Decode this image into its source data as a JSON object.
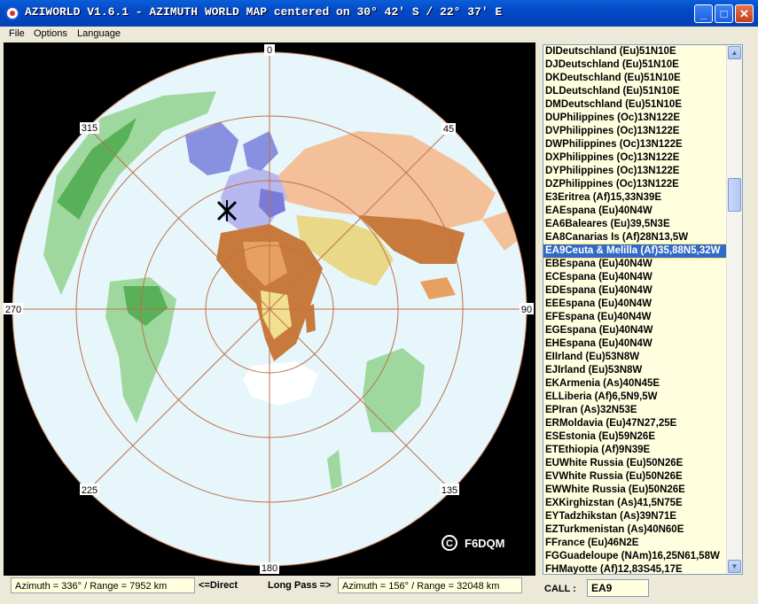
{
  "window": {
    "title": "AZIWORLD V1.6.1 - AZIMUTH WORLD MAP centered on 30° 42' S / 22° 37' E",
    "minimize": "_",
    "maximize": "□",
    "close": "✕"
  },
  "menu": {
    "items": [
      "File",
      "Options",
      "Language"
    ]
  },
  "map": {
    "bearings": [
      "0",
      "45",
      "90",
      "135",
      "180",
      "225",
      "270",
      "315"
    ],
    "credit_symbol": "C",
    "credit": "F6DQM"
  },
  "list": {
    "items": [
      "DIDeutschland (Eu)51N10E",
      "DJDeutschland (Eu)51N10E",
      "DKDeutschland (Eu)51N10E",
      "DLDeutschland (Eu)51N10E",
      "DMDeutschland (Eu)51N10E",
      "DUPhilippines (Oc)13N122E",
      "DVPhilippines (Oc)13N122E",
      "DWPhilippines (Oc)13N122E",
      "DXPhilippines (Oc)13N122E",
      "DYPhilippines (Oc)13N122E",
      "DZPhilippines (Oc)13N122E",
      "E3Eritrea (Af)15,33N39E",
      "EAEspana (Eu)40N4W",
      "EA6Baleares (Eu)39,5N3E",
      "EA8Canarias Is (Af)28N13,5W",
      "EA9Ceuta & Melilla (Af)35,88N5,32W",
      "EBEspana (Eu)40N4W",
      "ECEspana (Eu)40N4W",
      "EDEspana (Eu)40N4W",
      "EEEspana (Eu)40N4W",
      "EFEspana (Eu)40N4W",
      "EGEspana (Eu)40N4W",
      "EHEspana (Eu)40N4W",
      "EIIrland (Eu)53N8W",
      "EJIrland (Eu)53N8W",
      "EKArmenia (As)40N45E",
      "ELLiberia (Af)6,5N9,5W",
      "EPIran (As)32N53E",
      "ERMoldavia (Eu)47N27,25E",
      "ESEstonia (Eu)59N26E",
      "ETEthiopia (Af)9N39E",
      "EUWhite Russia (Eu)50N26E",
      "EVWhite Russia (Eu)50N26E",
      "EWWhite Russia (Eu)50N26E",
      "EXKirghizstan (As)41,5N75E",
      "EYTadzhikstan (As)39N71E",
      "EZTurkmenistan (As)40N60E",
      "FFrance (Eu)46N2E",
      "FGGuadeloupe (NAm)16,25N61,58W",
      "FHMayotte (Af)12,83S45,17E"
    ],
    "selected_index": 15
  },
  "status": {
    "direct_value": "Azimuth = 336° / Range = 7952 km",
    "direct_label": "<=Direct",
    "longpass_label": "Long Pass =>",
    "longpass_value": "Azimuth = 156° / Range = 32048 km",
    "call_label": "CALL :",
    "call_value": "EA9"
  },
  "colors": {
    "ocean": "#e6f6fa",
    "grid": "#c0704a",
    "selection": "#316ac5",
    "list_bg": "#ffffe0"
  }
}
